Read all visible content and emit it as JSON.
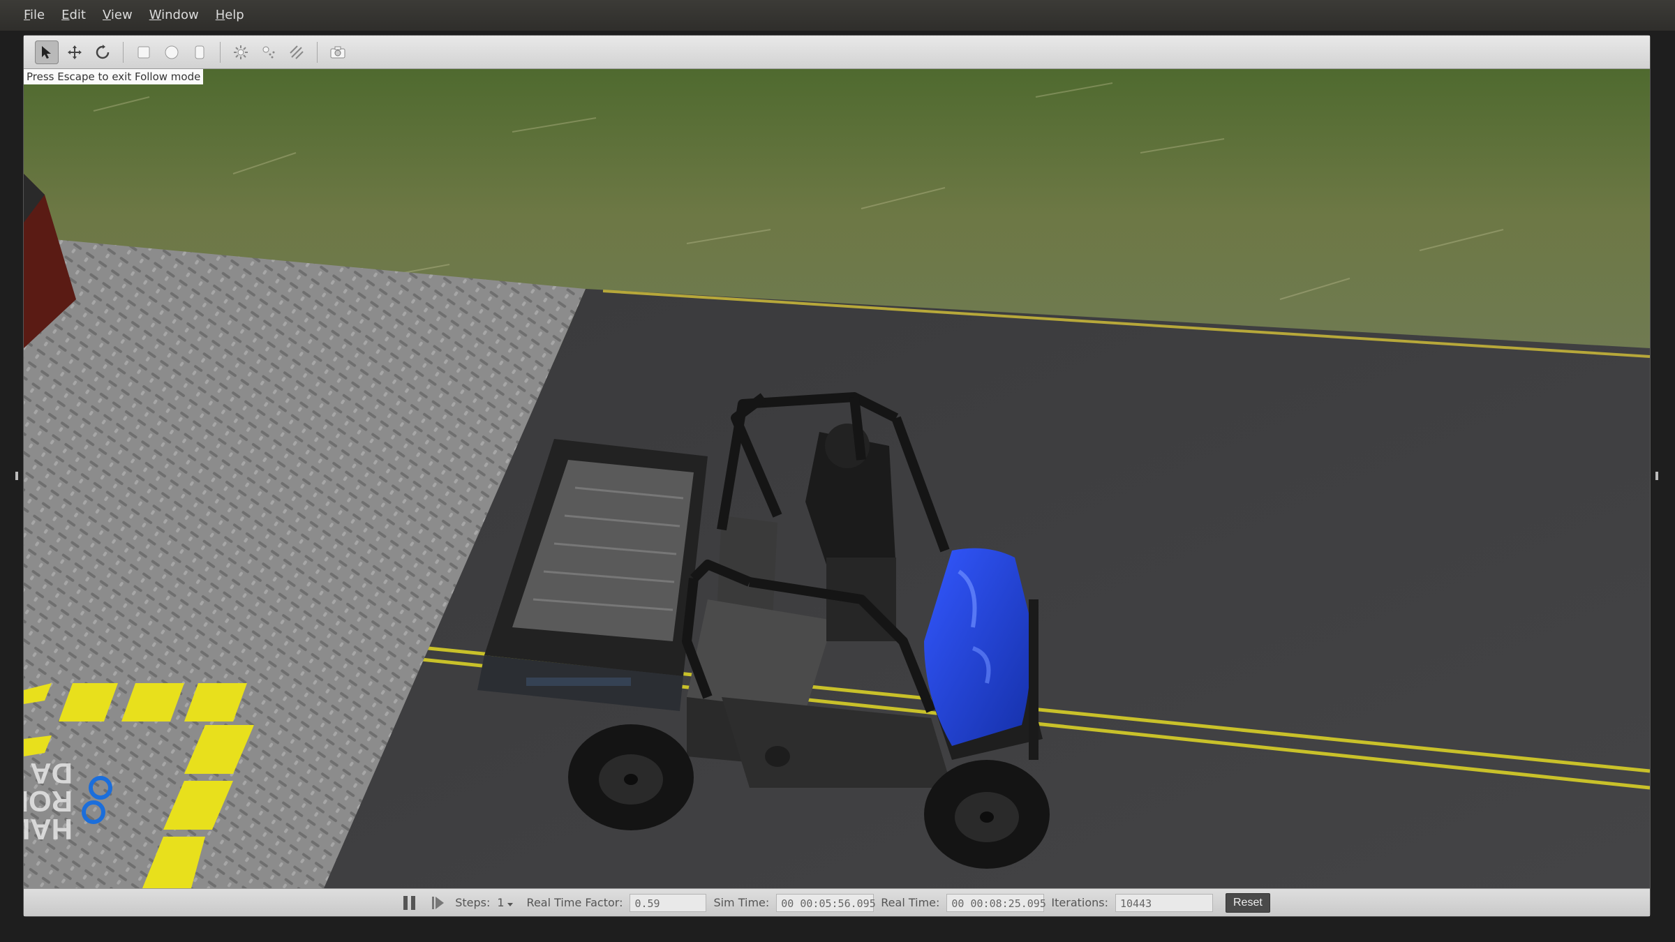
{
  "menu": [
    "File",
    "Edit",
    "View",
    "Window",
    "Help"
  ],
  "toolbar": {
    "tools": [
      "select-mode-icon",
      "translate-mode-icon",
      "rotate-mode-icon",
      "box-shape-icon",
      "sphere-shape-icon",
      "cylinder-shape-icon",
      "point-light-icon",
      "spot-light-icon",
      "directional-light-icon",
      "screenshot-camera-icon"
    ],
    "active_tool": "select-mode-icon"
  },
  "viewport": {
    "hint": "Press Escape to exit Follow mode",
    "colors": {
      "grass": "#5d6e3c",
      "road": "#3c3c3e",
      "plate": "#8a8a8a",
      "hood": "#1f3fd0",
      "stripe": "#d8d120"
    }
  },
  "statusbar": {
    "steps_label": "Steps:",
    "steps_value": "1",
    "rtf_label": "Real Time Factor:",
    "rtf_value": "0.59",
    "sim_label": "Sim Time:",
    "sim_value": "00 00:05:56.095",
    "real_label": "Real Time:",
    "real_value": "00 00:08:25.095",
    "iter_label": "Iterations:",
    "iter_value": "10443",
    "reset_label": "Reset"
  }
}
